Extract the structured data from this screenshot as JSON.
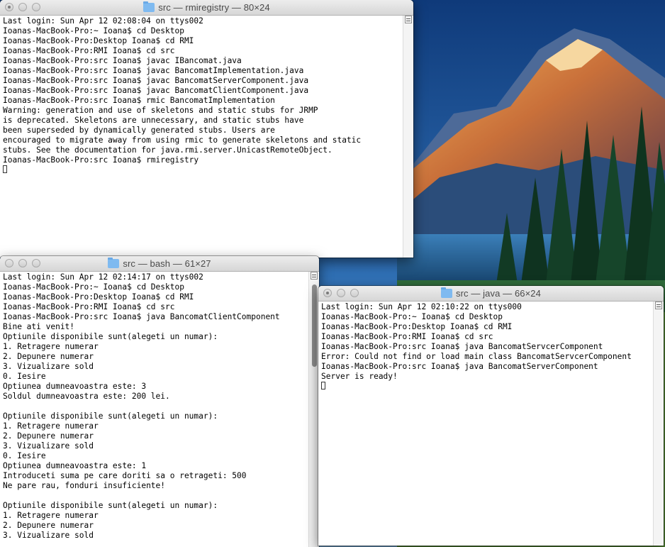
{
  "windows": {
    "rmiregistry": {
      "title": "src — rmiregistry — 80×24",
      "lines": [
        "Last login: Sun Apr 12 02:08:04 on ttys002",
        "Ioanas-MacBook-Pro:~ Ioana$ cd Desktop",
        "Ioanas-MacBook-Pro:Desktop Ioana$ cd RMI",
        "Ioanas-MacBook-Pro:RMI Ioana$ cd src",
        "Ioanas-MacBook-Pro:src Ioana$ javac IBancomat.java",
        "Ioanas-MacBook-Pro:src Ioana$ javac BancomatImplementation.java",
        "Ioanas-MacBook-Pro:src Ioana$ javac BancomatServerComponent.java",
        "Ioanas-MacBook-Pro:src Ioana$ javac BancomatClientComponent.java",
        "Ioanas-MacBook-Pro:src Ioana$ rmic BancomatImplementation",
        "Warning: generation and use of skeletons and static stubs for JRMP",
        "is deprecated. Skeletons are unnecessary, and static stubs have",
        "been superseded by dynamically generated stubs. Users are",
        "encouraged to migrate away from using rmic to generate skeletons and static",
        "stubs. See the documentation for java.rmi.server.UnicastRemoteObject.",
        "Ioanas-MacBook-Pro:src Ioana$ rmiregistry"
      ]
    },
    "bash": {
      "title": "src — bash — 61×27",
      "lines": [
        "Last login: Sun Apr 12 02:14:17 on ttys002",
        "Ioanas-MacBook-Pro:~ Ioana$ cd Desktop",
        "Ioanas-MacBook-Pro:Desktop Ioana$ cd RMI",
        "Ioanas-MacBook-Pro:RMI Ioana$ cd src",
        "Ioanas-MacBook-Pro:src Ioana$ java BancomatClientComponent",
        "Bine ati venit!",
        "Optiunile disponibile sunt(alegeti un numar):",
        "1. Retragere numerar",
        "2. Depunere numerar",
        "3. Vizualizare sold",
        "0. Iesire",
        "Optiunea dumneavoastra este: 3",
        "Soldul dumneavoastra este: 200 lei.",
        "",
        "Optiunile disponibile sunt(alegeti un numar):",
        "1. Retragere numerar",
        "2. Depunere numerar",
        "3. Vizualizare sold",
        "0. Iesire",
        "Optiunea dumneavoastra este: 1",
        "Introduceti suma pe care doriti sa o retrageti: 500",
        "Ne pare rau, fonduri insuficiente!",
        "",
        "Optiunile disponibile sunt(alegeti un numar):",
        "1. Retragere numerar",
        "2. Depunere numerar",
        "3. Vizualizare sold"
      ]
    },
    "java": {
      "title": "src — java — 66×24",
      "lines": [
        "Last login: Sun Apr 12 02:10:22 on ttys000",
        "Ioanas-MacBook-Pro:~ Ioana$ cd Desktop",
        "Ioanas-MacBook-Pro:Desktop Ioana$ cd RMI",
        "Ioanas-MacBook-Pro:RMI Ioana$ cd src",
        "Ioanas-MacBook-Pro:src Ioana$ java BancomatServcerComponent",
        "Error: Could not find or load main class BancomatServcerComponent",
        "Ioanas-MacBook-Pro:src Ioana$ java BancomatServerComponent",
        "Server is ready!"
      ]
    }
  }
}
